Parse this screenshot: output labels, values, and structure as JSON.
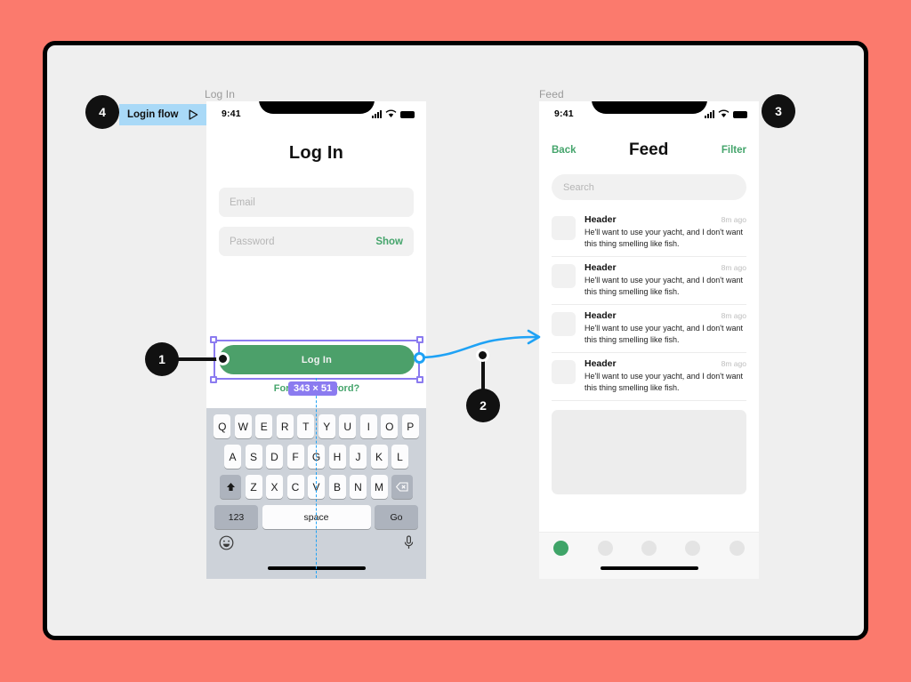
{
  "canvas": {
    "background_color": "#FB7A6D",
    "surface_color": "#EFEFEF",
    "accent_green": "#4CA06A",
    "selection_purple": "#8B7BF0",
    "connector_blue": "#1FA2F5",
    "flow_badge_blue": "#A9D9F7"
  },
  "frames": {
    "login_label": "Log In",
    "feed_label": "Feed"
  },
  "flow_badge": {
    "label": "Login flow",
    "icon": "play-triangle-icon"
  },
  "callouts": [
    {
      "number": "1"
    },
    {
      "number": "2"
    },
    {
      "number": "3"
    },
    {
      "number": "4"
    }
  ],
  "selection": {
    "size_badge": "343 × 51"
  },
  "login_screen": {
    "status_bar": {
      "time": "9:41",
      "signal": "signal-icon",
      "wifi": "wifi-icon",
      "battery": "battery-icon"
    },
    "title": "Log In",
    "email_placeholder": "Email",
    "password_placeholder": "Password",
    "show_label": "Show",
    "primary_button": "Log In",
    "forgot_label": "Forgot Password?",
    "keyboard": {
      "row1": [
        "Q",
        "W",
        "E",
        "R",
        "T",
        "Y",
        "U",
        "I",
        "O",
        "P"
      ],
      "row2": [
        "A",
        "S",
        "D",
        "F",
        "G",
        "H",
        "J",
        "K",
        "L"
      ],
      "row3": [
        "Z",
        "X",
        "C",
        "V",
        "B",
        "N",
        "M"
      ],
      "shift_icon": "shift-icon",
      "backspace_icon": "backspace-icon",
      "numbers_key": "123",
      "space_key": "space",
      "go_key": "Go",
      "emoji_icon": "emoji-icon",
      "mic_icon": "microphone-icon"
    }
  },
  "feed_screen": {
    "status_bar": {
      "time": "9:41",
      "signal": "signal-icon",
      "wifi": "wifi-icon",
      "battery": "battery-icon"
    },
    "back_label": "Back",
    "title": "Feed",
    "filter_label": "Filter",
    "search_placeholder": "Search",
    "items": [
      {
        "header": "Header",
        "time": "8m ago",
        "text": "He'll want to use your yacht, and I don't want this thing smelling like fish."
      },
      {
        "header": "Header",
        "time": "8m ago",
        "text": "He'll want to use your yacht, and I don't want this thing smelling like fish."
      },
      {
        "header": "Header",
        "time": "8m ago",
        "text": "He'll want to use your yacht, and I don't want this thing smelling like fish."
      },
      {
        "header": "Header",
        "time": "8m ago",
        "text": "He'll want to use your yacht, and I don't want this thing smelling like fish."
      }
    ],
    "tab_dots": 5,
    "active_tab_index": 0
  }
}
